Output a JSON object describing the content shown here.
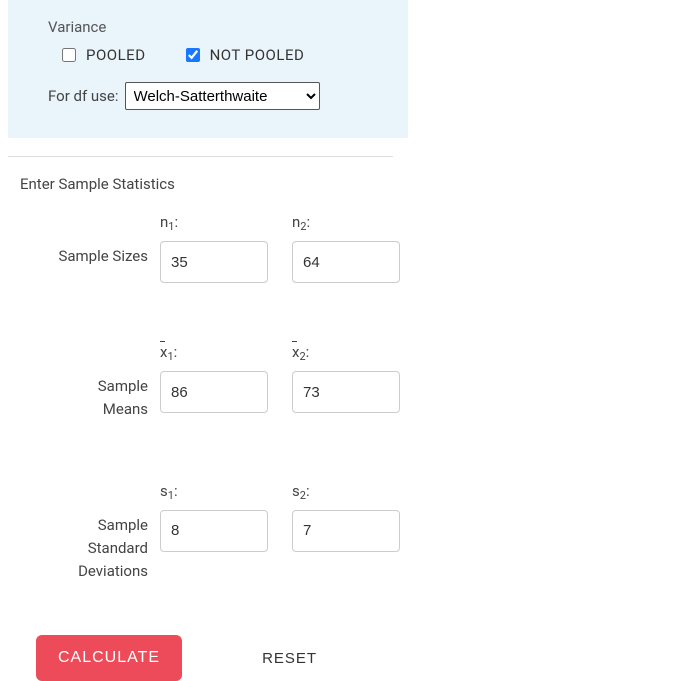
{
  "variance": {
    "title": "Variance",
    "pooled_label": "POOLED",
    "pooled_checked": false,
    "not_pooled_label": "NOT POOLED",
    "not_pooled_checked": true,
    "df_label": "For df use:",
    "df_selected": "Welch-Satterthwaite"
  },
  "section_title": "Enter Sample Statistics",
  "rows": {
    "sizes": {
      "label": "Sample Sizes",
      "l1": "n",
      "l2": "n",
      "v1": "35",
      "v2": "64"
    },
    "means": {
      "label": "Sample Means",
      "l1": "x",
      "l2": "x",
      "v1": "86",
      "v2": "73"
    },
    "sds": {
      "label": "Sample Standard Deviations",
      "l1": "s",
      "l2": "s",
      "v1": "8",
      "v2": "7"
    }
  },
  "buttons": {
    "calculate": "CALCULATE",
    "reset": "RESET"
  }
}
